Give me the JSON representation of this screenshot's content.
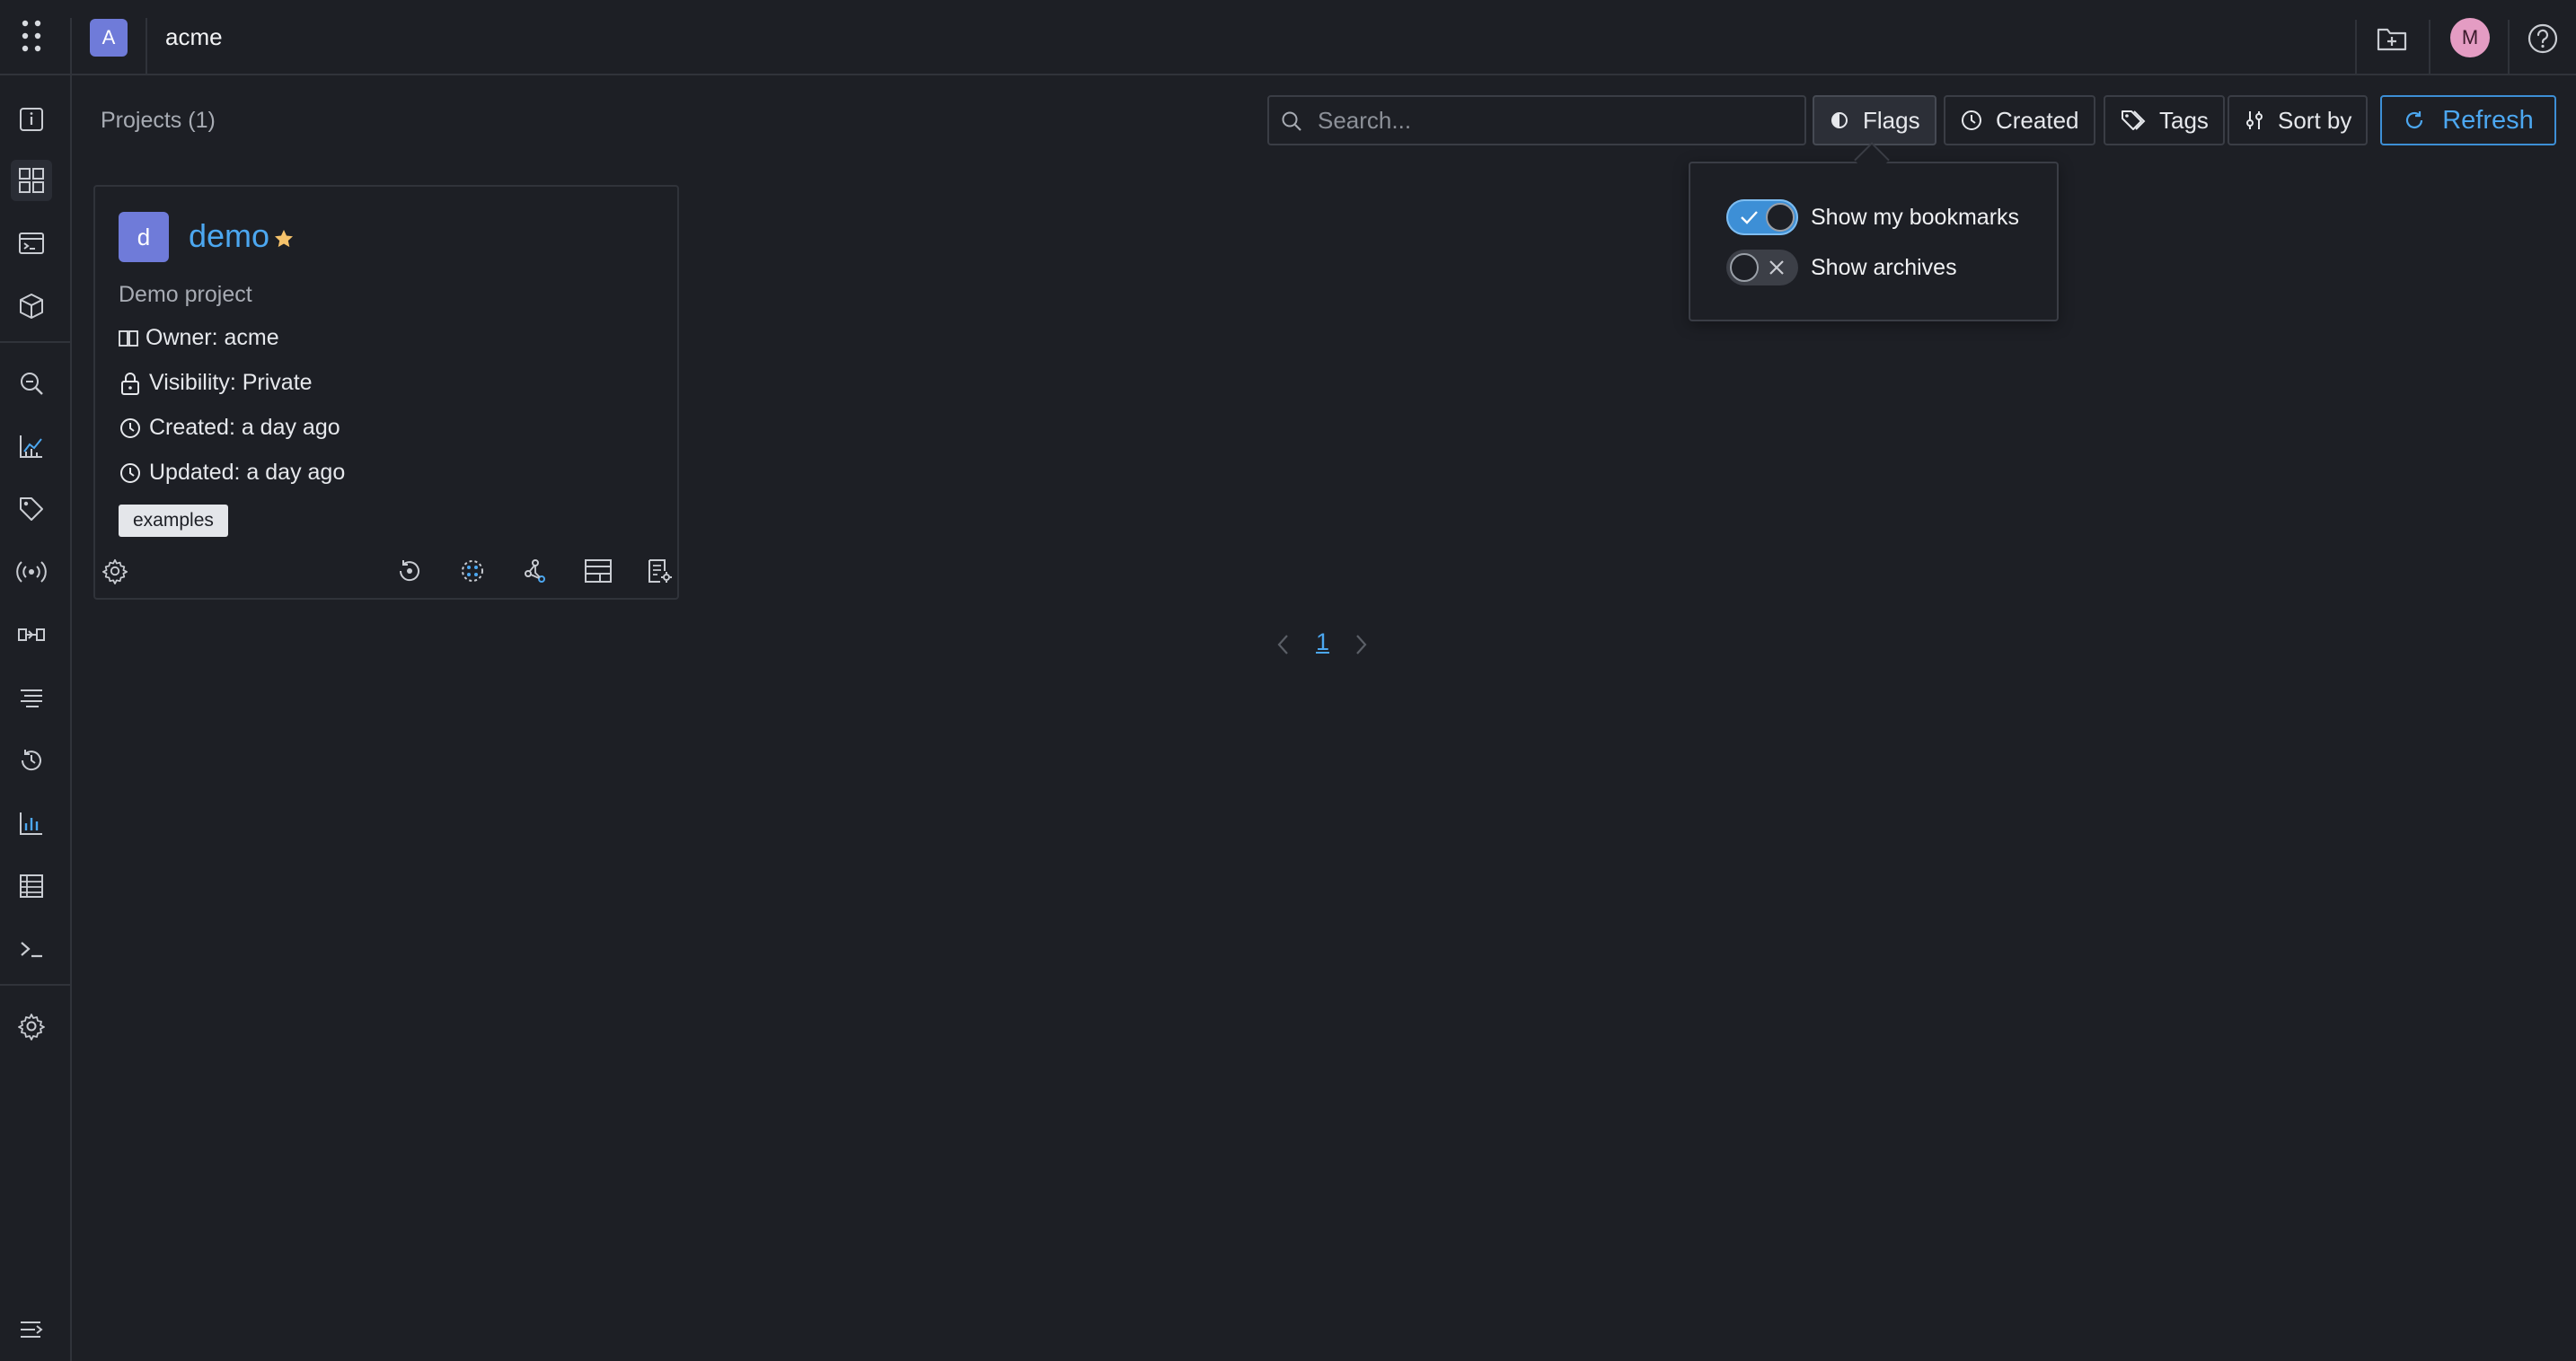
{
  "topbar": {
    "org_initial": "A",
    "org_name": "acme",
    "user_initial": "M"
  },
  "sidebar": {
    "items": [
      {
        "icon": "info-icon"
      },
      {
        "icon": "dashboard-grid-icon",
        "active": true
      },
      {
        "icon": "terminal-window-icon"
      },
      {
        "icon": "package-icon"
      },
      {
        "icon": "search-zoom-icon"
      },
      {
        "icon": "analytics-chart-icon"
      },
      {
        "icon": "tag-icon"
      },
      {
        "icon": "broadcast-icon"
      },
      {
        "icon": "pipeline-icon"
      },
      {
        "icon": "filter-lines-icon"
      },
      {
        "icon": "history-icon"
      },
      {
        "icon": "bar-chart-icon"
      },
      {
        "icon": "table-list-icon"
      },
      {
        "icon": "console-prompt-icon"
      },
      {
        "icon": "settings-gear-icon"
      },
      {
        "icon": "expand-menu-icon"
      }
    ]
  },
  "toolbar": {
    "projects_title": "Projects (1)",
    "search_placeholder": "Search...",
    "search_value": "",
    "flags_label": "Flags",
    "created_label": "Created",
    "tags_label": "Tags",
    "sort_label": "Sort by",
    "refresh_label": "Refresh"
  },
  "flags_popover": {
    "show_bookmarks_label": "Show my bookmarks",
    "show_bookmarks_on": true,
    "show_archives_label": "Show archives",
    "show_archives_on": false
  },
  "projects": [
    {
      "initial": "d",
      "name": "demo",
      "bookmarked": true,
      "description": "Demo project",
      "owner": "Owner: acme",
      "visibility": "Visibility: Private",
      "created": "Created: a day ago",
      "updated": "Updated: a day ago",
      "tags": [
        "examples"
      ]
    }
  ],
  "pagination": {
    "current_page": "1"
  },
  "colors": {
    "background": "#1d1f25",
    "accent": "#4ca7f0",
    "avatar": "#6f7bd9",
    "user_avatar": "#e49cc3",
    "star": "#f5c26b"
  }
}
